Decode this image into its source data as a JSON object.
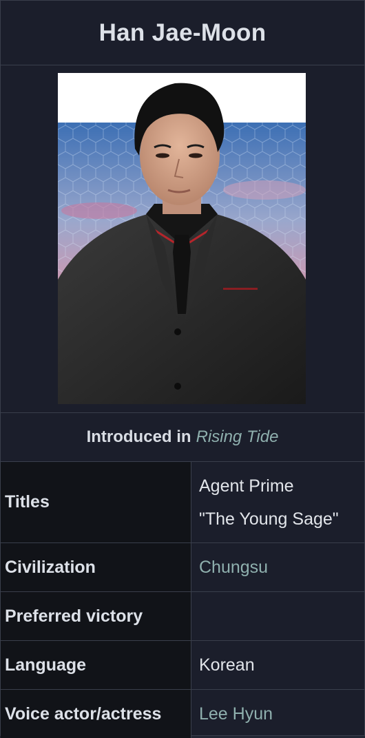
{
  "title": "Han Jae-Moon",
  "portrait": {
    "alt": "Han Jae-Moon"
  },
  "intro": {
    "label": "Introduced in",
    "game": "Rising Tide"
  },
  "rows": {
    "titles": {
      "label": "Titles",
      "lines": [
        "Agent Prime",
        "\"The Young Sage\""
      ]
    },
    "civilization": {
      "label": "Civilization",
      "value": "Chungsu"
    },
    "victory": {
      "label": "Preferred victory",
      "value": ""
    },
    "language": {
      "label": "Language",
      "value": "Korean"
    },
    "voice": {
      "label": "Voice actor/actress",
      "value": "Lee Hyun"
    }
  },
  "colors": {
    "link": "#8fb0ae",
    "background": "#1b1e2b",
    "label_background": "#111318"
  }
}
